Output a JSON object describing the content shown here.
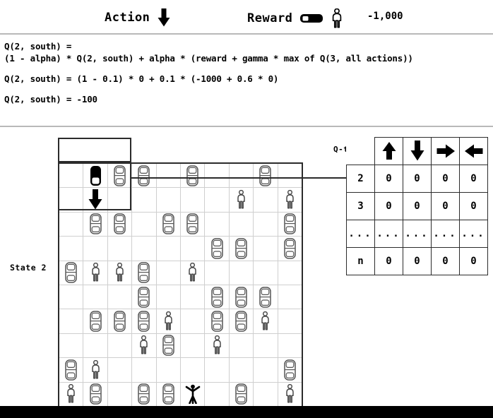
{
  "header": {
    "action_label": "Action",
    "action_icon": "arrow-down-icon",
    "reward_label": "Reward",
    "reward_car_icon": "car-black-icon",
    "reward_pedestrian_icon": "pedestrian-icon",
    "reward_value": "-1,000"
  },
  "equations": {
    "block1_line1": "Q(2, south) =",
    "block1_line2": "(1 - alpha) * Q(2, south) + alpha * (reward + gamma * max of Q(3, all actions))",
    "block2": "Q(2, south) = (1 - 0.1) * 0 + 0.1 * (-1000 + 0.6 * 0)",
    "block3": "Q(2, south) = -100"
  },
  "grid": {
    "state_label": "State 2",
    "rows": 10,
    "cols": 10,
    "cells": [
      [
        "",
        "car-black",
        "car",
        "car",
        "",
        "car",
        "",
        "",
        "car",
        ""
      ],
      [
        "",
        "arrow-down",
        "",
        "",
        "",
        "",
        "",
        "person",
        "",
        "person"
      ],
      [
        "",
        "car",
        "car",
        "",
        "car",
        "car",
        "",
        "",
        "",
        "car"
      ],
      [
        "",
        "",
        "",
        "",
        "",
        "",
        "car",
        "car",
        "",
        "car"
      ],
      [
        "car",
        "person",
        "person",
        "car",
        "",
        "person",
        "",
        "",
        "",
        ""
      ],
      [
        "",
        "",
        "",
        "car",
        "",
        "",
        "car",
        "car",
        "car",
        ""
      ],
      [
        "",
        "car",
        "car",
        "car",
        "person",
        "",
        "car",
        "car",
        "person",
        ""
      ],
      [
        "",
        "",
        "",
        "person",
        "car",
        "",
        "person",
        "",
        "",
        ""
      ],
      [
        "car",
        "person",
        "",
        "",
        "",
        "",
        "",
        "",
        "",
        "car"
      ],
      [
        "person",
        "car",
        "",
        "car",
        "car",
        "person-black-raised",
        "",
        "car",
        "",
        "person"
      ]
    ]
  },
  "qtable": {
    "label": "Q-table",
    "columns": [
      "arrow-up-icon",
      "arrow-down-icon",
      "arrow-right-icon",
      "arrow-left-icon"
    ],
    "rows": [
      {
        "state": "2",
        "values": [
          "0",
          "0",
          "0",
          "0"
        ]
      },
      {
        "state": "3",
        "values": [
          "0",
          "0",
          "0",
          "0"
        ]
      },
      {
        "state": "...",
        "values": [
          "...",
          "...",
          "...",
          "..."
        ]
      },
      {
        "state": "n",
        "values": [
          "0",
          "0",
          "0",
          "0"
        ]
      }
    ]
  },
  "colors": {
    "ink": "#000000",
    "grid_line": "#cfcfcf",
    "frame": "#2b2b2b",
    "divider": "#b9b9b9",
    "footer": "#000000"
  }
}
